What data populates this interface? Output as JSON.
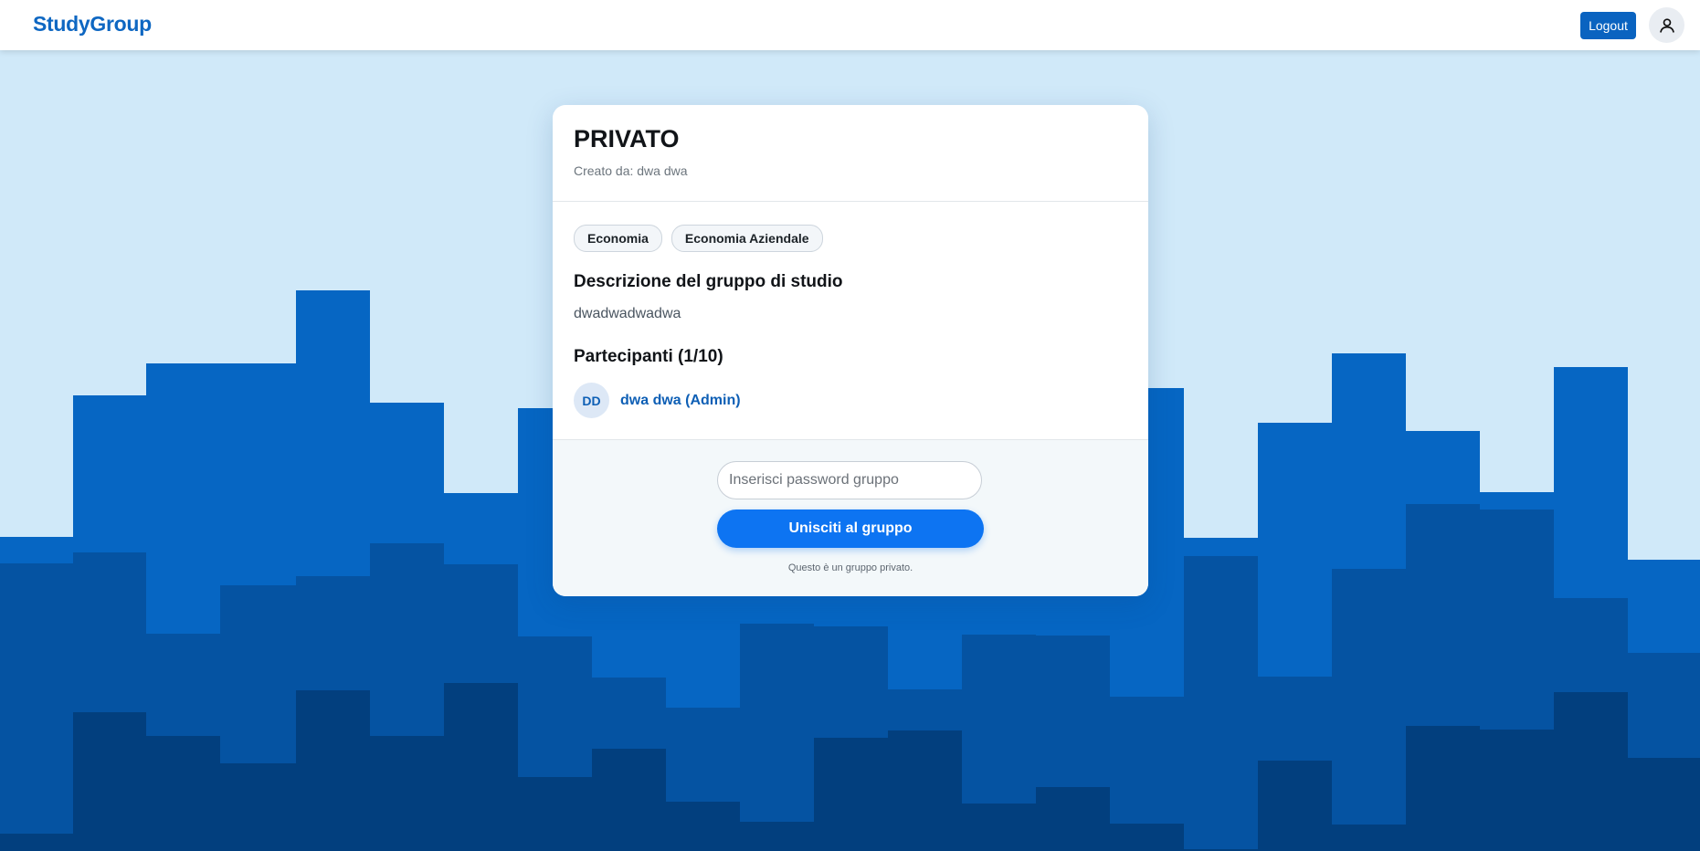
{
  "header": {
    "brand": "StudyGroup",
    "logout_label": "Logout",
    "avatar_icon": "user-icon"
  },
  "group": {
    "title": "PRIVATO",
    "created_by": "Creato da: dwa dwa",
    "tags": [
      "Economia",
      "Economia Aziendale"
    ],
    "description_title": "Descrizione del gruppo di studio",
    "description": "dwadwadwadwa",
    "participants_title": "Partecipanti (1/10)",
    "participants": [
      {
        "initials": "DD",
        "name": "dwa dwa (Admin)"
      }
    ]
  },
  "join": {
    "password_placeholder": "Inserisci password gruppo",
    "join_label": "Unisciti al gruppo",
    "note": "Questo è un gruppo privato."
  },
  "colors": {
    "sky": "#d0e9f9",
    "brand": "#0e67c2",
    "primary": "#0d74f2",
    "skyline_layers": [
      "#0666c3",
      "#0553a2",
      "#023f7e"
    ]
  }
}
